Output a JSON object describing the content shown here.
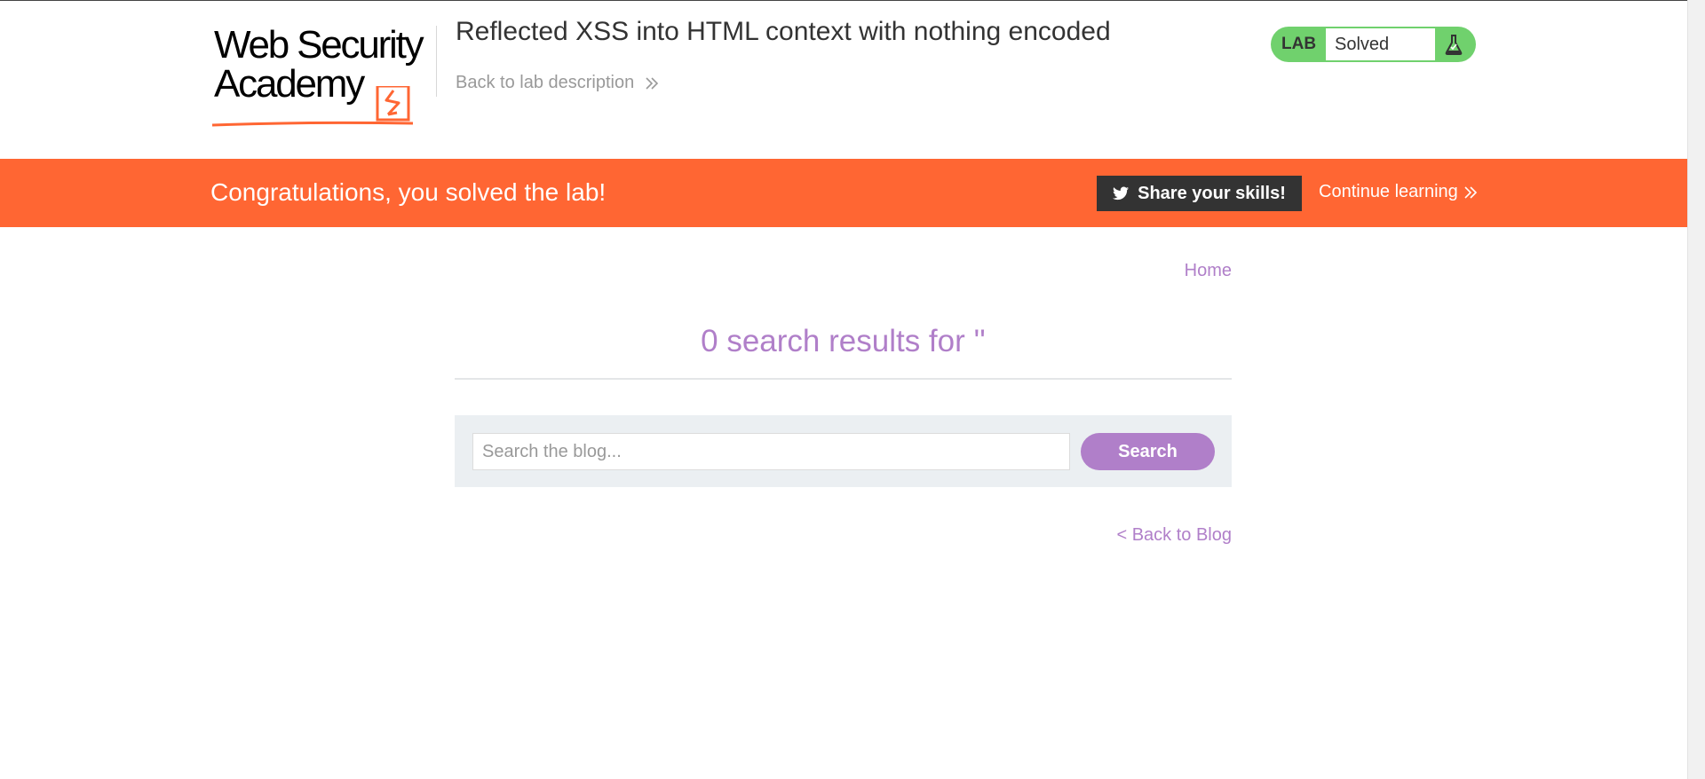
{
  "header": {
    "logo_line1": "Web Security",
    "logo_line2": "Academy",
    "lab_title": "Reflected XSS into HTML context with nothing encoded",
    "back_link": "Back to lab description",
    "lab_badge": {
      "label": "LAB",
      "status": "Solved",
      "icon": "flask-icon"
    }
  },
  "banner": {
    "message": "Congratulations, you solved the lab!",
    "share_button": "Share your skills!",
    "share_icon": "twitter-icon",
    "continue_link": "Continue learning"
  },
  "nav": {
    "home": "Home"
  },
  "search": {
    "results_heading": "0 search results for ''",
    "placeholder": "Search the blog...",
    "value": "",
    "button": "Search"
  },
  "footer_nav": {
    "back_to_blog": "< Back to Blog"
  },
  "colors": {
    "brand_orange": "#ff6633",
    "accent_purple": "#b07fc9",
    "lab_green": "#70d16d",
    "dark": "#333333"
  }
}
